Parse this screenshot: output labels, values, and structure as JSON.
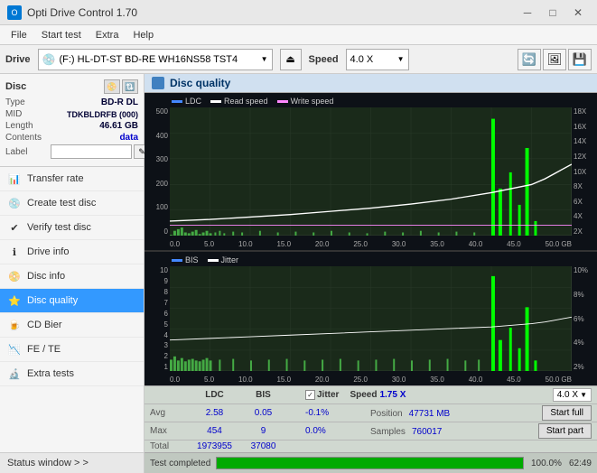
{
  "titleBar": {
    "title": "Opti Drive Control 1.70",
    "minimize": "─",
    "maximize": "□",
    "close": "✕"
  },
  "menuBar": {
    "items": [
      "File",
      "Start test",
      "Extra",
      "Help"
    ]
  },
  "driveBar": {
    "label": "Drive",
    "driveValue": "(F:)  HL-DT-ST BD-RE  WH16NS58 TST4",
    "speedLabel": "Speed",
    "speedValue": "4.0 X"
  },
  "discPanel": {
    "title": "Disc",
    "fields": [
      {
        "label": "Type",
        "value": "BD-R DL"
      },
      {
        "label": "MID",
        "value": "TDKBLDRFB (000)"
      },
      {
        "label": "Length",
        "value": "46.61 GB"
      },
      {
        "label": "Contents",
        "value": "data"
      },
      {
        "label": "Label",
        "value": ""
      }
    ]
  },
  "navItems": [
    {
      "id": "transfer-rate",
      "label": "Transfer rate",
      "icon": "📊"
    },
    {
      "id": "create-test-disc",
      "label": "Create test disc",
      "icon": "💿"
    },
    {
      "id": "verify-test-disc",
      "label": "Verify test disc",
      "icon": "✔"
    },
    {
      "id": "drive-info",
      "label": "Drive info",
      "icon": "ℹ"
    },
    {
      "id": "disc-info",
      "label": "Disc info",
      "icon": "📀"
    },
    {
      "id": "disc-quality",
      "label": "Disc quality",
      "icon": "⭐",
      "active": true
    },
    {
      "id": "cd-bier",
      "label": "CD Bier",
      "icon": "🍺"
    },
    {
      "id": "fe-te",
      "label": "FE / TE",
      "icon": "📉"
    },
    {
      "id": "extra-tests",
      "label": "Extra tests",
      "icon": "🔬"
    }
  ],
  "statusWindow": {
    "label": "Status window > >"
  },
  "discQuality": {
    "title": "Disc quality",
    "legend": {
      "ldc": "LDC",
      "readSpeed": "Read speed",
      "writeSpeed": "Write speed"
    },
    "legendBottom": {
      "bis": "BIS",
      "jitter": "Jitter"
    },
    "xLabels": [
      "0.0",
      "5.0",
      "10.0",
      "15.0",
      "20.0",
      "25.0",
      "30.0",
      "35.0",
      "40.0",
      "45.0",
      "50.0 GB"
    ],
    "yLabelsTop": [
      "500",
      "400",
      "300",
      "200",
      "100",
      "0"
    ],
    "yLabelsTopRight": [
      "18X",
      "16X",
      "14X",
      "12X",
      "10X",
      "8X",
      "6X",
      "4X",
      "2X"
    ],
    "yLabelsBottom": [
      "10",
      "9",
      "8",
      "7",
      "6",
      "5",
      "4",
      "3",
      "2",
      "1"
    ],
    "yLabelsBottomRight": [
      "10%",
      "8%",
      "6%",
      "4%",
      "2%"
    ]
  },
  "stats": {
    "columns": [
      "",
      "LDC",
      "BIS",
      "",
      "Jitter",
      "Speed",
      ""
    ],
    "avg": {
      "ldc": "2.58",
      "bis": "0.05",
      "jitter": "-0.1%"
    },
    "max": {
      "ldc": "454",
      "bis": "9",
      "jitter": "0.0%"
    },
    "total": {
      "ldc": "1973955",
      "bis": "37080"
    },
    "speed": {
      "val": "1.75 X"
    },
    "speedDropdown": "4.0 X",
    "position": {
      "label": "Position",
      "val": "47731 MB"
    },
    "samples": {
      "label": "Samples",
      "val": "760017"
    },
    "startFull": "Start full",
    "startPart": "Start part",
    "avgLabel": "Avg",
    "maxLabel": "Max",
    "totalLabel": "Total",
    "jitterLabel": "Jitter",
    "speedLabel": "Speed",
    "positionLabel": "Position",
    "samplesLabel": "Samples"
  },
  "progressBar": {
    "statusLabel": "Test completed",
    "fillPercent": 100,
    "percentText": "100.0%",
    "timeText": "62:49"
  }
}
